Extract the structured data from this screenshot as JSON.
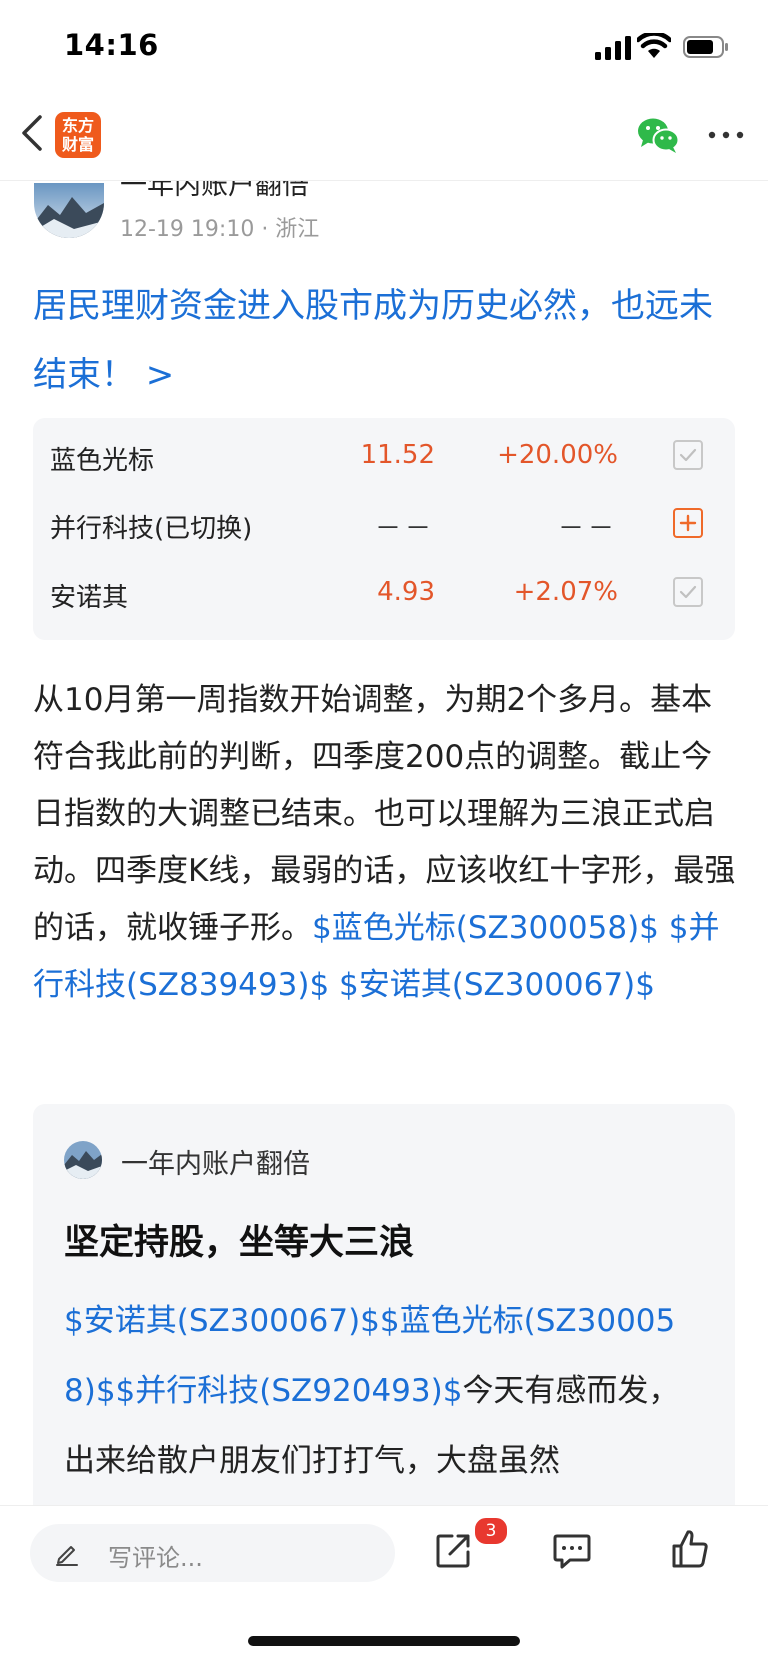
{
  "status_bar": {
    "time": "14:16"
  },
  "nav": {
    "logo_line1": "东方",
    "logo_line2": "财富",
    "brand_color": "#ef5a1c"
  },
  "post": {
    "author": "一年内账户翻倍",
    "meta": "12-19 19:10  · 浙江",
    "title": "居民理财资金进入股市成为历史必然，也远未结束！ >",
    "stocks": [
      {
        "name": "蓝色光标",
        "price": "11.52",
        "change": "+20.00%",
        "action": "check-icon"
      },
      {
        "name": "并行科技(已切换)",
        "price": "－－",
        "change": "－－",
        "action": "add-icon"
      },
      {
        "name": "安诺其",
        "price": "4.93",
        "change": "+2.07%",
        "action": "check-icon"
      }
    ],
    "body_text": "从10月第一周指数开始调整，为期2个多月。基本符合我此前的判断，四季度200点的调整。截止今日指数的大调整已结束。也可以理解为三浪正式启动。四季度K线，最弱的话，应该收红十字形，最强的话，就收锤子形。",
    "body_links": [
      "$蓝色光标(SZ300058)$",
      "$并行科技(SZ839493)$",
      "$安诺其(SZ300067)$"
    ]
  },
  "quote": {
    "author": "一年内账户翻倍",
    "title": "坚定持股，坐等大三浪",
    "links": [
      "$安诺其(SZ300067)$",
      "$蓝色光标(SZ300058)$",
      "$并行科技(SZ920493)$"
    ],
    "text": "今天有感而发，出来给散户朋友们打打气，大盘虽然"
  },
  "bottom_bar": {
    "comment_placeholder": "写评论...",
    "share_badge": "3"
  },
  "colors": {
    "link": "#1b6fd6",
    "up": "#e3562a",
    "badge": "#e8382f"
  }
}
